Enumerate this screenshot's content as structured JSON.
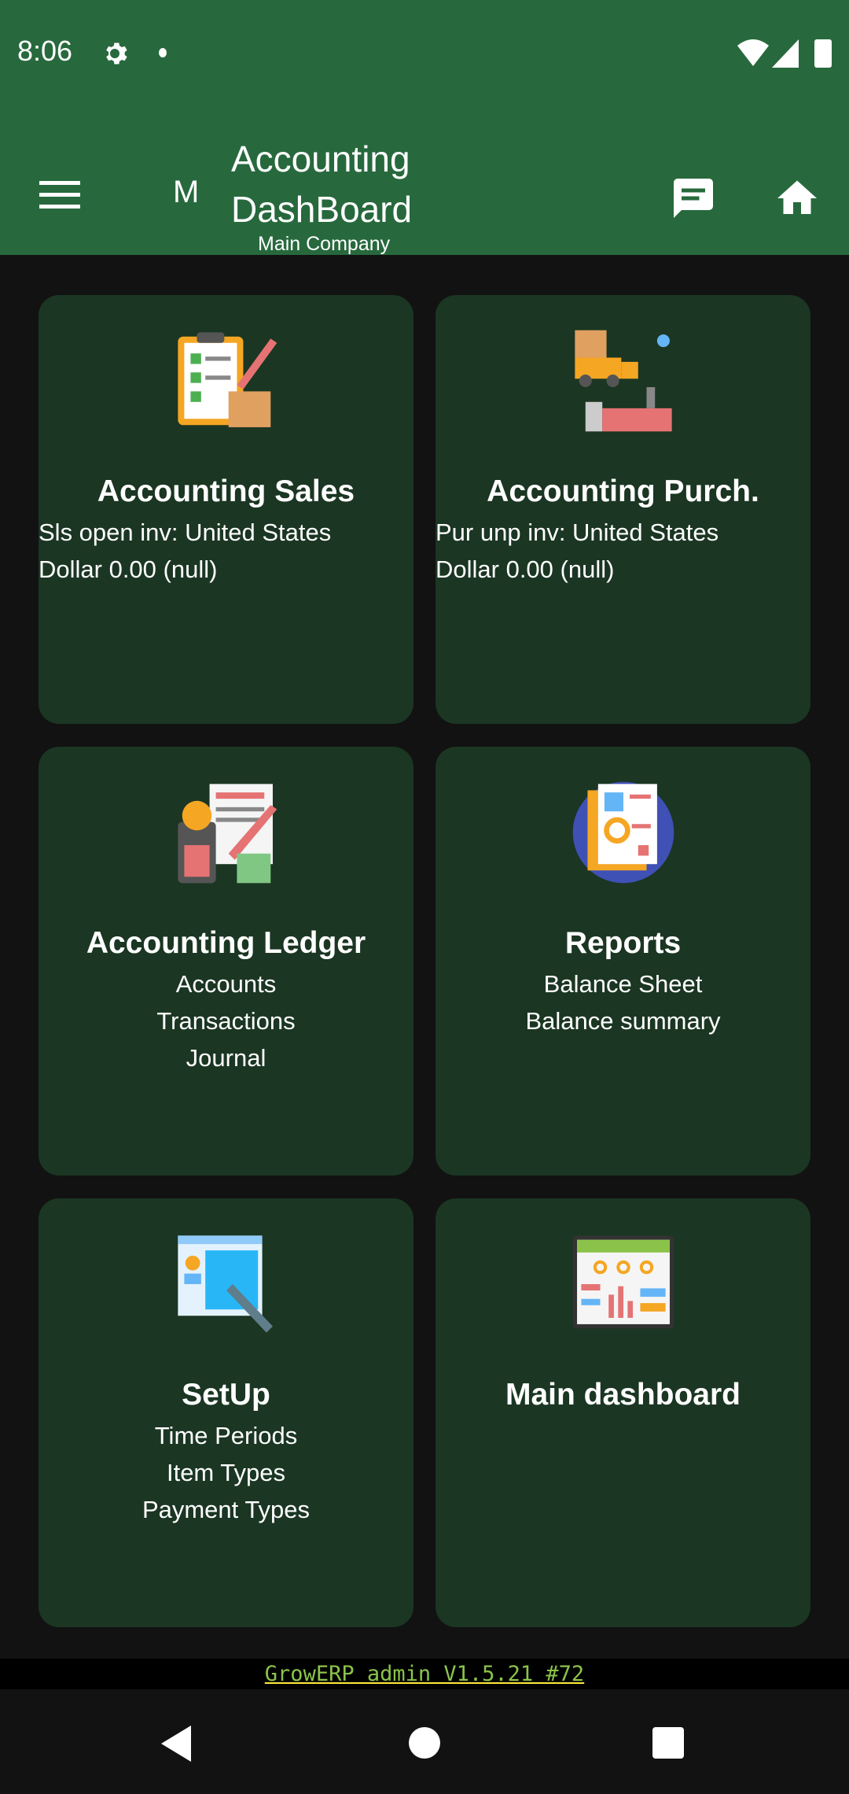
{
  "status_bar": {
    "time": "8:06"
  },
  "app_bar": {
    "avatar_letter": "M",
    "title_line1": "Accounting",
    "title_line2": "DashBoard",
    "company": "Main Company"
  },
  "cards": [
    {
      "title": "Accounting Sales",
      "lines": [
        "Sls open inv: United States",
        "Dollar 0.00 (null)"
      ]
    },
    {
      "title": "Accounting Purch.",
      "lines": [
        "Pur unp inv: United States",
        "Dollar 0.00 (null)"
      ]
    },
    {
      "title": "Accounting Ledger",
      "lines": [
        "Accounts",
        "Transactions",
        "Journal"
      ]
    },
    {
      "title": "Reports",
      "lines": [
        "Balance Sheet",
        "Balance summary"
      ]
    },
    {
      "title": "SetUp",
      "lines": [
        "Time Periods",
        "Item Types",
        "Payment Types"
      ]
    },
    {
      "title": "Main dashboard",
      "lines": []
    }
  ],
  "footer": {
    "version": "GrowERP admin V1.5.21 #72"
  }
}
